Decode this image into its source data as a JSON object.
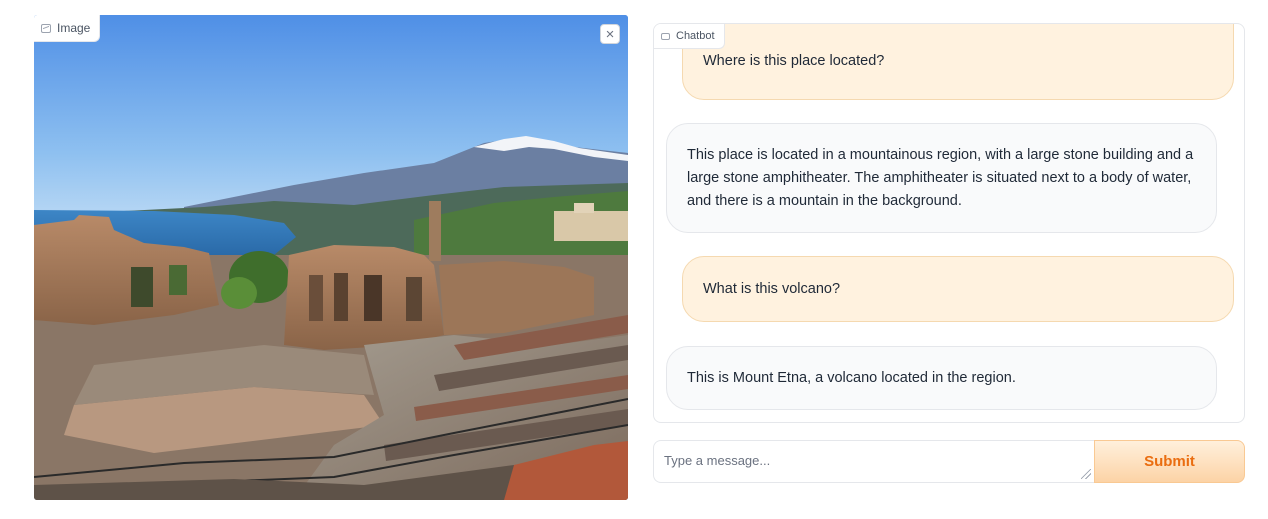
{
  "image_panel": {
    "label": "Image",
    "label_icon": "image-icon",
    "close_icon": "close-icon",
    "close_symbol": "×",
    "photo_description_icon": "photo-greek-theatre-taormina-etna"
  },
  "chatbot": {
    "label": "Chatbot",
    "label_icon": "chat-icon",
    "messages": [
      {
        "role": "user",
        "text": "Where is this place located?"
      },
      {
        "role": "bot",
        "text": "This place is located in a mountainous region, with a large stone building and a large stone amphitheater. The amphitheater is situated next to a body of water, and there is a mountain in the background."
      },
      {
        "role": "user",
        "text": "What is this volcano?"
      },
      {
        "role": "bot",
        "text": "This is Mount Etna, a volcano located in the region."
      }
    ]
  },
  "input": {
    "placeholder": "Type a message...",
    "value": ""
  },
  "submit": {
    "label": "Submit"
  },
  "colors": {
    "user_bubble": "#fff2df",
    "bot_bubble": "#f9fafb",
    "submit_text": "#ea6d10",
    "submit_bg": "#fcd3a6"
  }
}
